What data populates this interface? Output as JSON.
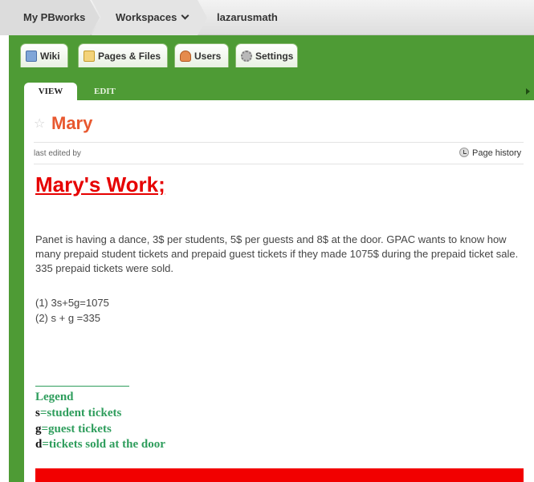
{
  "breadcrumb": {
    "home": "My PBworks",
    "workspaces": "Workspaces",
    "workspace": "lazarusmath"
  },
  "tabs": [
    {
      "label": "Wiki",
      "icon": "wiki-icon"
    },
    {
      "label": "Pages & Files",
      "icon": "pages-icon"
    },
    {
      "label": "Users",
      "icon": "users-icon"
    },
    {
      "label": "Settings",
      "icon": "settings-icon"
    }
  ],
  "mode_tabs": {
    "view": "VIEW",
    "edit": "EDIT"
  },
  "page": {
    "title": "Mary",
    "last_edited": "last edited by",
    "history_label": "Page history"
  },
  "content": {
    "heading": "Mary's Work;",
    "paragraph": "Panet is having a dance, 3$ per students, 5$ per guests and 8$ at the door. GPAC wants to know how many prepaid student tickets and prepaid guest tickets if they made 1075$ during the prepaid ticket sale. 335 prepaid tickets were sold.",
    "equation1": "(1) 3s+5g=1075",
    "equation2": "(2) s + g =335",
    "legend_title": "Legend",
    "legend": [
      {
        "var": "s",
        "text": "=student tickets"
      },
      {
        "var": "g",
        "text": "=guest tickets"
      },
      {
        "var": "d",
        "text": "=tickets sold at the door"
      }
    ]
  },
  "colors": {
    "brand_green": "#4e9b35",
    "title_orange": "#e8582f",
    "heading_red": "#e60000",
    "legend_green": "#2e9d5c"
  }
}
